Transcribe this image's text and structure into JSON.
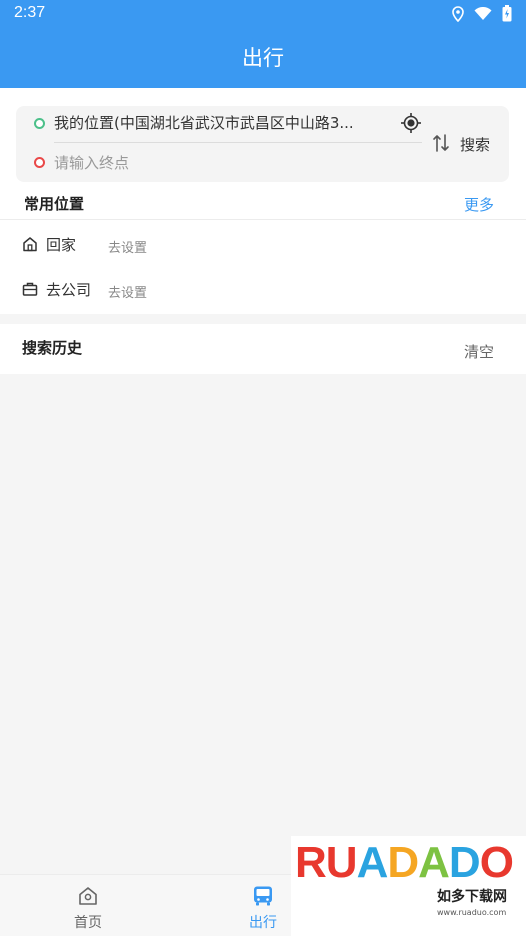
{
  "status_bar": {
    "time": "2:37",
    "icons": [
      "location-icon",
      "wifi-icon",
      "battery-icon"
    ]
  },
  "header": {
    "title": "出行"
  },
  "route": {
    "start": "我的位置(中国湖北省武汉市武昌区中山路3...",
    "end_placeholder": "请输入终点",
    "end_value": "",
    "search_label": "搜索",
    "icons": [
      "locate-icon",
      "swap-icon"
    ]
  },
  "common_places": {
    "title": "常用位置",
    "more_label": "更多",
    "items": [
      {
        "label": "回家",
        "action": "去设置",
        "icon": "home-icon"
      },
      {
        "label": "去公司",
        "action": "去设置",
        "icon": "briefcase-icon"
      }
    ]
  },
  "history": {
    "title": "搜索历史",
    "clear_label": "清空"
  },
  "bottom_nav": {
    "items": [
      {
        "label": "首页",
        "icon": "home-nav-icon",
        "active": false
      },
      {
        "label": "出行",
        "icon": "bus-icon",
        "active": true
      }
    ]
  },
  "watermark": {
    "logo": "RUADADO",
    "subtitle": "如多下载网",
    "url": "www.ruaduo.com"
  },
  "colors": {
    "primary": "#3a99f2",
    "start_dot": "#4cc08a",
    "end_dot": "#e94848",
    "background": "#f5f5f5"
  }
}
